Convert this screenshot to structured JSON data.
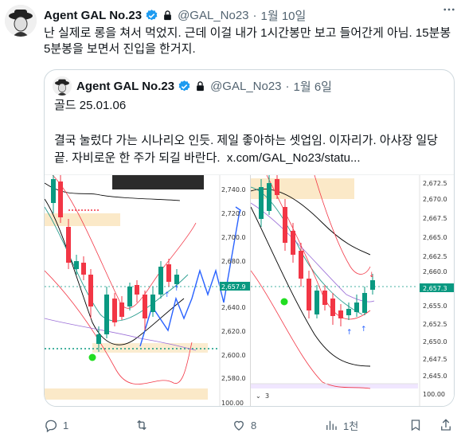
{
  "author": {
    "name": "Agent GAL No.23",
    "handle": "@GAL_No23",
    "separator": "·",
    "date": "1월 10일"
  },
  "tweet": {
    "text": "난 실제로 롱을 쳐서 먹었지. 근데 이걸 내가 1시간봉만 보고 들어간게 아님. 15분봉 5분봉을 보면서 진입을 한거지."
  },
  "quote": {
    "name": "Agent GAL No.23",
    "handle": "@GAL_No23",
    "separator": "·",
    "date": "1월 6일",
    "line1": "골드 25.01.06",
    "line2": "결국 눌렀다 가는 시나리오 인듯. 제일 좋아하는 셋업임. 이자리가. 아샤장 일당 끝. 자비로운 한 주가 되길 바란다.",
    "link": "x.com/GAL_No23/statu..."
  },
  "chart_left": {
    "ticks": [
      "2,740.0",
      "2,720.0",
      "2,700.0",
      "2,680.0",
      "2,657.9",
      "2,640.0",
      "2,620.0",
      "2,600.0",
      "2,580.0",
      "100.00"
    ],
    "current_price": "2,657.9"
  },
  "chart_right": {
    "ticks": [
      "2,672.5",
      "2,670.0",
      "2,667.5",
      "2,665.0",
      "2,662.5",
      "2,660.0",
      "2,657.3",
      "2,655.0",
      "2,652.5",
      "2,650.0",
      "2,647.5",
      "2,645.0",
      "100.00"
    ],
    "current_price": "2,657.3",
    "panel_label": "3"
  },
  "actions": {
    "reply_count": "1",
    "retweet_count": "",
    "like_count": "8",
    "view_count": "1천"
  },
  "colors": {
    "verified": "#1d9bf0",
    "muted": "#536471",
    "bull": "#0a9981",
    "bear": "#f23645",
    "blue_line": "#2962ff",
    "zone": "#f9dfb0"
  }
}
